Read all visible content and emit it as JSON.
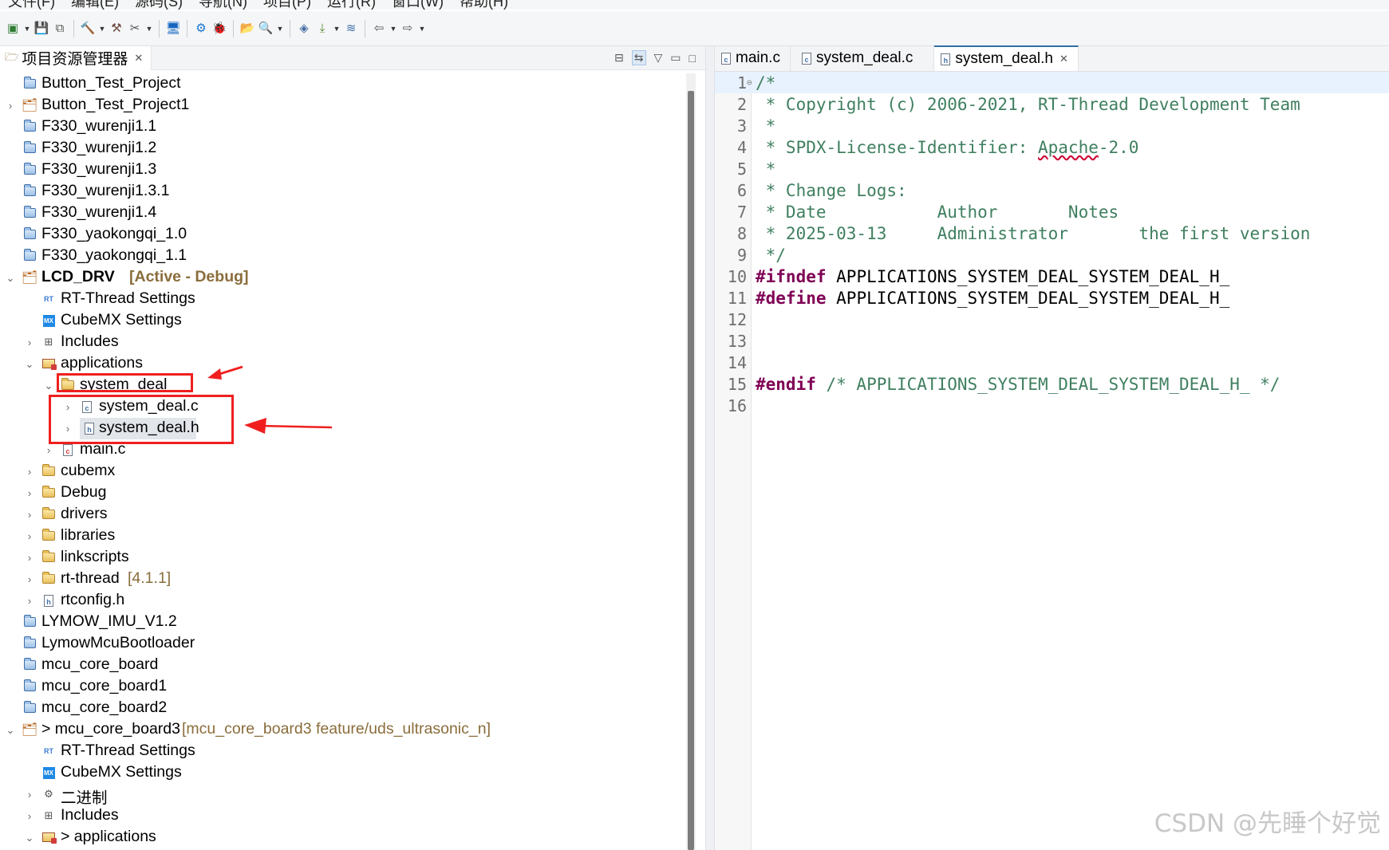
{
  "menu": [
    "文件(F)",
    "编辑(E)",
    "源码(S)",
    "导航(N)",
    "项目(P)",
    "运行(R)",
    "窗口(W)",
    "帮助(H)"
  ],
  "toolbar_icons": [
    "new-icon",
    "save-icon",
    "save-all-icon",
    "build-icon",
    "build-all-icon",
    "clean-icon",
    "monitor-icon",
    "debug-settings-icon",
    "debug-icon",
    "open-folder-icon",
    "search-icon",
    "package-icon",
    "download-icon",
    "layers-icon",
    "back-icon",
    "forward-icon"
  ],
  "explorer": {
    "title": "项目资源管理器",
    "tree": [
      {
        "label": "Button_Test_Project"
      },
      {
        "label": "Button_Test_Project1"
      },
      {
        "label": "F330_wurenji1.1"
      },
      {
        "label": "F330_wurenji1.2"
      },
      {
        "label": "F330_wurenji1.3"
      },
      {
        "label": "F330_wurenji1.3.1"
      },
      {
        "label": "F330_wurenji1.4"
      },
      {
        "label": "F330_yaokongqi_1.0"
      },
      {
        "label": "F330_yaokongqi_1.1"
      },
      {
        "label": "LCD_DRV",
        "decoration": "[Active - Debug]"
      },
      {
        "label": "RT-Thread Settings"
      },
      {
        "label": "CubeMX Settings"
      },
      {
        "label": "Includes"
      },
      {
        "label": "applications"
      },
      {
        "label": "system_deal"
      },
      {
        "label": "system_deal.c"
      },
      {
        "label": "system_deal.h"
      },
      {
        "label": "main.c"
      },
      {
        "label": "cubemx"
      },
      {
        "label": "Debug"
      },
      {
        "label": "drivers"
      },
      {
        "label": "libraries"
      },
      {
        "label": "linkscripts"
      },
      {
        "label": "rt-thread",
        "decoration": "[4.1.1]"
      },
      {
        "label": "rtconfig.h"
      },
      {
        "label": "LYMOW_IMU_V1.2"
      },
      {
        "label": "LymowMcuBootloader"
      },
      {
        "label": "mcu_core_board"
      },
      {
        "label": "mcu_core_board1"
      },
      {
        "label": "mcu_core_board2"
      },
      {
        "label": "> mcu_core_board3",
        "decoration": "[mcu_core_board3 feature/uds_ultrasonic_n]"
      },
      {
        "label": "RT-Thread Settings"
      },
      {
        "label": "CubeMX Settings"
      },
      {
        "label": "二进制"
      },
      {
        "label": "Includes"
      },
      {
        "label": "> applications"
      }
    ]
  },
  "editor": {
    "tabs": [
      {
        "label": "main.c"
      },
      {
        "label": "system_deal.c"
      },
      {
        "label": "system_deal.h",
        "active": true
      }
    ],
    "lines": [
      {
        "n": "1",
        "text": "/*"
      },
      {
        "n": "2",
        "text": " * Copyright (c) 2006-2021, RT-Thread Development Team"
      },
      {
        "n": "3",
        "text": " *"
      },
      {
        "n": "4",
        "text_a": " * SPDX-License-Identifier: ",
        "text_b": "Apache",
        "text_c": "-2.0"
      },
      {
        "n": "5",
        "text": " *"
      },
      {
        "n": "6",
        "text": " * Change Logs:"
      },
      {
        "n": "7",
        "text": " * Date           Author       Notes"
      },
      {
        "n": "8",
        "text": " * 2025-03-13     Administrator       the first version"
      },
      {
        "n": "9",
        "text": " */"
      },
      {
        "n": "10",
        "kw": "#ifndef",
        "rest": " APPLICATIONS_SYSTEM_DEAL_SYSTEM_DEAL_H_"
      },
      {
        "n": "11",
        "kw": "#define",
        "rest": " APPLICATIONS_SYSTEM_DEAL_SYSTEM_DEAL_H_"
      },
      {
        "n": "12",
        "text": ""
      },
      {
        "n": "13",
        "text": ""
      },
      {
        "n": "14",
        "text": ""
      },
      {
        "n": "15",
        "kw": "#endif",
        "cm": " /* APPLICATIONS_SYSTEM_DEAL_SYSTEM_DEAL_H_ */"
      },
      {
        "n": "16",
        "text": ""
      }
    ]
  },
  "watermark": "CSDN @先睡个好觉",
  "colors": {
    "annotation": "#f01f1f",
    "comment": "#3f7f5f",
    "keyword": "#7f0055",
    "decoration": "#8a6d3b"
  }
}
